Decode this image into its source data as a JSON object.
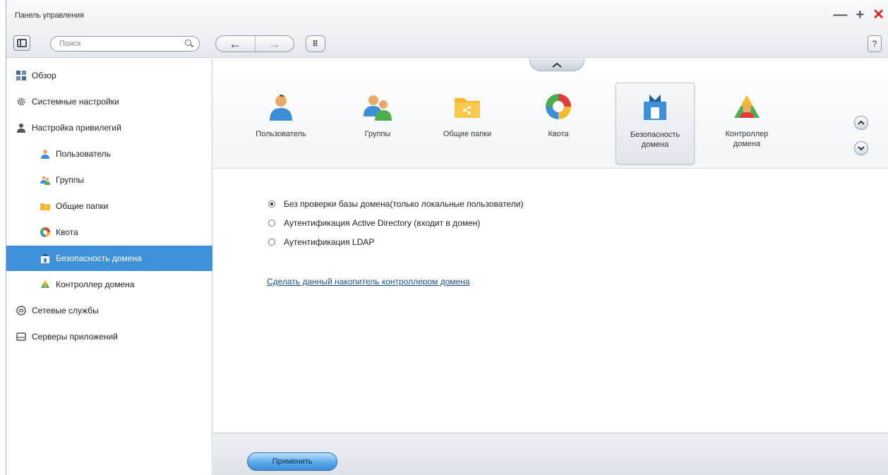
{
  "window": {
    "title": "Панель управления",
    "controls": {
      "minimize": "—",
      "maximize": "+",
      "close": "✕"
    }
  },
  "toolbar": {
    "search_placeholder": "Поиск",
    "back": "←",
    "forward": "→",
    "apps": "⠿",
    "help": "?"
  },
  "sidebar": {
    "items": [
      {
        "label": "Обзор",
        "icon": "overview-icon",
        "level": 0
      },
      {
        "label": "Системные настройки",
        "icon": "gear-icon",
        "level": 0
      },
      {
        "label": "Настройка привилегий",
        "icon": "user-icon",
        "level": 0
      },
      {
        "label": "Пользователь",
        "icon": "user-icon",
        "level": 1
      },
      {
        "label": "Группы",
        "icon": "group-icon",
        "level": 1
      },
      {
        "label": "Общие папки",
        "icon": "folder-icon",
        "level": 1
      },
      {
        "label": "Квота",
        "icon": "quota-icon",
        "level": 1
      },
      {
        "label": "Безопасность домена",
        "icon": "domain-security-icon",
        "level": 1,
        "active": true
      },
      {
        "label": "Контроллер домена",
        "icon": "domain-controller-icon",
        "level": 1
      },
      {
        "label": "Сетевые службы",
        "icon": "network-icon",
        "level": 0
      },
      {
        "label": "Серверы приложений",
        "icon": "server-icon",
        "level": 0
      }
    ]
  },
  "tiles": [
    {
      "label": "Пользователь",
      "icon": "user-icon"
    },
    {
      "label": "Группы",
      "icon": "group-icon"
    },
    {
      "label": "Общие папки",
      "icon": "folder-icon"
    },
    {
      "label": "Квота",
      "icon": "quota-icon"
    },
    {
      "label": "Безопасность\nдомена",
      "icon": "domain-security-icon",
      "selected": true
    },
    {
      "label": "Контроллер\nдомена",
      "icon": "domain-controller-icon"
    }
  ],
  "content": {
    "options": [
      {
        "label": "Без проверки базы домена(только локальные пользователи)",
        "checked": true
      },
      {
        "label": "Аутентификация Active Directory (входит в домен)",
        "checked": false
      },
      {
        "label": "Аутентификация LDAP",
        "checked": false
      }
    ],
    "link": "Сделать данный накопитель контроллером домена"
  },
  "footer": {
    "apply_label": "Применить"
  },
  "colors": {
    "accent": "#3f91d8",
    "link": "#1a4e8c",
    "close": "#dd2222"
  }
}
